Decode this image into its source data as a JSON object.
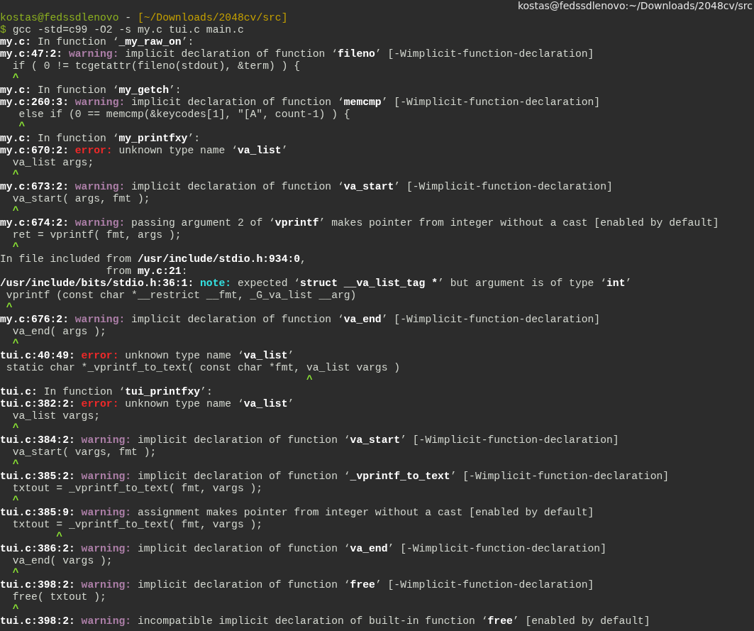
{
  "window": {
    "title": "kostas@fedssdlenovo:~/Downloads/2048cv/src"
  },
  "lines": [
    [
      {
        "kind": "user",
        "text": "kostas@fedssdlenovo"
      },
      {
        "kind": "text",
        "text": " - "
      },
      {
        "kind": "path",
        "text": "[~/Downloads/2048cv/src]"
      }
    ],
    [
      {
        "kind": "user",
        "text": "$"
      },
      {
        "kind": "text",
        "text": " gcc -std=c99 -O2 -s my.c tui.c main.c"
      }
    ],
    [
      {
        "kind": "bold",
        "text": "my.c:"
      },
      {
        "kind": "text",
        "text": " In function ‘"
      },
      {
        "kind": "bold",
        "text": "_my_raw_on"
      },
      {
        "kind": "text",
        "text": "’:"
      }
    ],
    [
      {
        "kind": "bold",
        "text": "my.c:47:2:"
      },
      {
        "kind": "warning",
        "text": " warning:"
      },
      {
        "kind": "text",
        "text": " implicit declaration of function ‘"
      },
      {
        "kind": "bold",
        "text": "fileno"
      },
      {
        "kind": "text",
        "text": "’ [-Wimplicit-function-declaration]"
      }
    ],
    [
      {
        "kind": "text",
        "text": "  if ( 0 != tcgetattr(fileno(stdout), &term) ) {"
      }
    ],
    [
      {
        "kind": "caret",
        "text": "  ^"
      }
    ],
    [
      {
        "kind": "bold",
        "text": "my.c:"
      },
      {
        "kind": "text",
        "text": " In function ‘"
      },
      {
        "kind": "bold",
        "text": "my_getch"
      },
      {
        "kind": "text",
        "text": "’:"
      }
    ],
    [
      {
        "kind": "bold",
        "text": "my.c:260:3:"
      },
      {
        "kind": "warning",
        "text": " warning:"
      },
      {
        "kind": "text",
        "text": " implicit declaration of function ‘"
      },
      {
        "kind": "bold",
        "text": "memcmp"
      },
      {
        "kind": "text",
        "text": "’ [-Wimplicit-function-declaration]"
      }
    ],
    [
      {
        "kind": "text",
        "text": "   else if (0 == memcmp(&keycodes[1], \"[A\", count-1) ) {"
      }
    ],
    [
      {
        "kind": "caret",
        "text": "   ^"
      }
    ],
    [
      {
        "kind": "bold",
        "text": "my.c:"
      },
      {
        "kind": "text",
        "text": " In function ‘"
      },
      {
        "kind": "bold",
        "text": "my_printfxy"
      },
      {
        "kind": "text",
        "text": "’:"
      }
    ],
    [
      {
        "kind": "bold",
        "text": "my.c:670:2:"
      },
      {
        "kind": "error",
        "text": " error:"
      },
      {
        "kind": "text",
        "text": " unknown type name ‘"
      },
      {
        "kind": "bold",
        "text": "va_list"
      },
      {
        "kind": "text",
        "text": "’"
      }
    ],
    [
      {
        "kind": "text",
        "text": "  va_list args;"
      }
    ],
    [
      {
        "kind": "caret",
        "text": "  ^"
      }
    ],
    [
      {
        "kind": "bold",
        "text": "my.c:673:2:"
      },
      {
        "kind": "warning",
        "text": " warning:"
      },
      {
        "kind": "text",
        "text": " implicit declaration of function ‘"
      },
      {
        "kind": "bold",
        "text": "va_start"
      },
      {
        "kind": "text",
        "text": "’ [-Wimplicit-function-declaration]"
      }
    ],
    [
      {
        "kind": "text",
        "text": "  va_start( args, fmt );"
      }
    ],
    [
      {
        "kind": "caret",
        "text": "  ^"
      }
    ],
    [
      {
        "kind": "bold",
        "text": "my.c:674:2:"
      },
      {
        "kind": "warning",
        "text": " warning:"
      },
      {
        "kind": "text",
        "text": " passing argument 2 of ‘"
      },
      {
        "kind": "bold",
        "text": "vprintf"
      },
      {
        "kind": "text",
        "text": "’ makes pointer from integer without a cast [enabled by default]"
      }
    ],
    [
      {
        "kind": "text",
        "text": "  ret = vprintf( fmt, args );"
      }
    ],
    [
      {
        "kind": "caret",
        "text": "  ^"
      }
    ],
    [
      {
        "kind": "text",
        "text": "In file included from "
      },
      {
        "kind": "bold",
        "text": "/usr/include/stdio.h:934:0"
      },
      {
        "kind": "text",
        "text": ","
      }
    ],
    [
      {
        "kind": "text",
        "text": "                 from "
      },
      {
        "kind": "bold",
        "text": "my.c:21"
      },
      {
        "kind": "text",
        "text": ":"
      }
    ],
    [
      {
        "kind": "bold",
        "text": "/usr/include/bits/stdio.h:36:1:"
      },
      {
        "kind": "note",
        "text": " note:"
      },
      {
        "kind": "text",
        "text": " expected ‘"
      },
      {
        "kind": "bold",
        "text": "struct __va_list_tag *"
      },
      {
        "kind": "text",
        "text": "’ but argument is of type ‘"
      },
      {
        "kind": "bold",
        "text": "int"
      },
      {
        "kind": "text",
        "text": "’"
      }
    ],
    [
      {
        "kind": "text",
        "text": " vprintf (const char *__restrict __fmt, _G_va_list __arg)"
      }
    ],
    [
      {
        "kind": "caret",
        "text": " ^"
      }
    ],
    [
      {
        "kind": "bold",
        "text": "my.c:676:2:"
      },
      {
        "kind": "warning",
        "text": " warning:"
      },
      {
        "kind": "text",
        "text": " implicit declaration of function ‘"
      },
      {
        "kind": "bold",
        "text": "va_end"
      },
      {
        "kind": "text",
        "text": "’ [-Wimplicit-function-declaration]"
      }
    ],
    [
      {
        "kind": "text",
        "text": "  va_end( args );"
      }
    ],
    [
      {
        "kind": "caret",
        "text": "  ^"
      }
    ],
    [
      {
        "kind": "bold",
        "text": "tui.c:40:49:"
      },
      {
        "kind": "error",
        "text": " error:"
      },
      {
        "kind": "text",
        "text": " unknown type name ‘"
      },
      {
        "kind": "bold",
        "text": "va_list"
      },
      {
        "kind": "text",
        "text": "’"
      }
    ],
    [
      {
        "kind": "text",
        "text": " static char *_vprintf_to_text( const char *fmt, va_list vargs )"
      }
    ],
    [
      {
        "kind": "caret",
        "text": "                                                 ^"
      }
    ],
    [
      {
        "kind": "bold",
        "text": "tui.c:"
      },
      {
        "kind": "text",
        "text": " In function ‘"
      },
      {
        "kind": "bold",
        "text": "tui_printfxy"
      },
      {
        "kind": "text",
        "text": "’:"
      }
    ],
    [
      {
        "kind": "bold",
        "text": "tui.c:382:2:"
      },
      {
        "kind": "error",
        "text": " error:"
      },
      {
        "kind": "text",
        "text": " unknown type name ‘"
      },
      {
        "kind": "bold",
        "text": "va_list"
      },
      {
        "kind": "text",
        "text": "’"
      }
    ],
    [
      {
        "kind": "text",
        "text": "  va_list vargs;"
      }
    ],
    [
      {
        "kind": "caret",
        "text": "  ^"
      }
    ],
    [
      {
        "kind": "bold",
        "text": "tui.c:384:2:"
      },
      {
        "kind": "warning",
        "text": " warning:"
      },
      {
        "kind": "text",
        "text": " implicit declaration of function ‘"
      },
      {
        "kind": "bold",
        "text": "va_start"
      },
      {
        "kind": "text",
        "text": "’ [-Wimplicit-function-declaration]"
      }
    ],
    [
      {
        "kind": "text",
        "text": "  va_start( vargs, fmt );"
      }
    ],
    [
      {
        "kind": "caret",
        "text": "  ^"
      }
    ],
    [
      {
        "kind": "bold",
        "text": "tui.c:385:2:"
      },
      {
        "kind": "warning",
        "text": " warning:"
      },
      {
        "kind": "text",
        "text": " implicit declaration of function ‘"
      },
      {
        "kind": "bold",
        "text": "_vprintf_to_text"
      },
      {
        "kind": "text",
        "text": "’ [-Wimplicit-function-declaration]"
      }
    ],
    [
      {
        "kind": "text",
        "text": "  txtout = _vprintf_to_text( fmt, vargs );"
      }
    ],
    [
      {
        "kind": "caret",
        "text": "  ^"
      }
    ],
    [
      {
        "kind": "bold",
        "text": "tui.c:385:9:"
      },
      {
        "kind": "warning",
        "text": " warning:"
      },
      {
        "kind": "text",
        "text": " assignment makes pointer from integer without a cast [enabled by default]"
      }
    ],
    [
      {
        "kind": "text",
        "text": "  txtout = _vprintf_to_text( fmt, vargs );"
      }
    ],
    [
      {
        "kind": "caret",
        "text": "         ^"
      }
    ],
    [
      {
        "kind": "bold",
        "text": "tui.c:386:2:"
      },
      {
        "kind": "warning",
        "text": " warning:"
      },
      {
        "kind": "text",
        "text": " implicit declaration of function ‘"
      },
      {
        "kind": "bold",
        "text": "va_end"
      },
      {
        "kind": "text",
        "text": "’ [-Wimplicit-function-declaration]"
      }
    ],
    [
      {
        "kind": "text",
        "text": "  va_end( vargs );"
      }
    ],
    [
      {
        "kind": "caret",
        "text": "  ^"
      }
    ],
    [
      {
        "kind": "bold",
        "text": "tui.c:398:2:"
      },
      {
        "kind": "warning",
        "text": " warning:"
      },
      {
        "kind": "text",
        "text": " implicit declaration of function ‘"
      },
      {
        "kind": "bold",
        "text": "free"
      },
      {
        "kind": "text",
        "text": "’ [-Wimplicit-function-declaration]"
      }
    ],
    [
      {
        "kind": "text",
        "text": "  free( txtout );"
      }
    ],
    [
      {
        "kind": "caret",
        "text": "  ^"
      }
    ],
    [
      {
        "kind": "bold",
        "text": "tui.c:398:2:"
      },
      {
        "kind": "warning",
        "text": " warning:"
      },
      {
        "kind": "text",
        "text": " incompatible implicit declaration of built-in function ‘"
      },
      {
        "kind": "bold",
        "text": "free"
      },
      {
        "kind": "text",
        "text": "’ [enabled by default]"
      }
    ]
  ]
}
